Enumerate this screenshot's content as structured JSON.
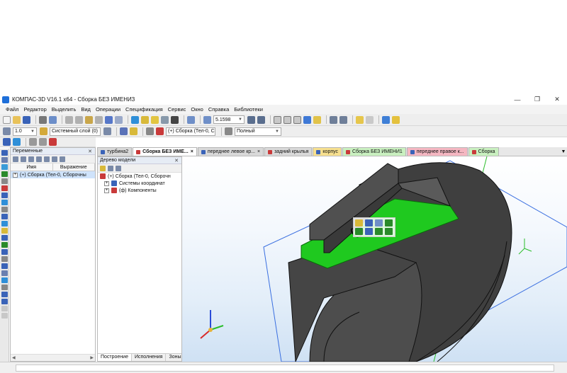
{
  "window": {
    "title": "КОМПАС-3D V16.1 x64 - Сборка БЕЗ ИМЕНИ3",
    "minimize": "—",
    "restore": "❐",
    "close": "✕"
  },
  "menu": [
    "Файл",
    "Редактор",
    "Выделить",
    "Вид",
    "Операции",
    "Спецификация",
    "Сервис",
    "Окно",
    "Справка",
    "Библиотеки"
  ],
  "toolbar1": {
    "zoom_value": "5.1598"
  },
  "toolbar2": {
    "line_scale": "1.0",
    "layer": "Системный слой (0)",
    "context": "(+) Сборка (Тел-0, С",
    "display_mode": "Полный"
  },
  "variables_panel": {
    "title": "Переменные",
    "pin": "✕",
    "col_name": "Имя",
    "col_expression": "Выражение",
    "rows": [
      {
        "expander": "+",
        "label": "(+) Сборка (Тел-0, Сборочны"
      }
    ]
  },
  "model_tree": {
    "title": "Дерево модели",
    "pin": "✕",
    "items": [
      {
        "level": 0,
        "expander": "",
        "label": "(+) Сборка (Тел-0, Сборочн"
      },
      {
        "level": 1,
        "expander": "+",
        "label": "Системы координат"
      },
      {
        "level": 1,
        "expander": "+",
        "label": "(ф) Компоненты"
      }
    ],
    "bottom_tabs": [
      "Построение",
      "Исполнения",
      "Зоны"
    ]
  },
  "doc_tabs": [
    {
      "label": "турбина2",
      "color": "#d9d9d9",
      "closable": false,
      "active": false
    },
    {
      "label": "Сборка БЕЗ ИМЕ...",
      "color": "#ffffff",
      "closable": true,
      "active": true
    },
    {
      "label": "переднее левое кр...",
      "color": "#d9d9d9",
      "closable": true,
      "active": false
    },
    {
      "label": "задний крылья",
      "color": "#d9d9d9",
      "closable": false,
      "active": false
    },
    {
      "label": "корпус",
      "color": "#f7e08f",
      "closable": false,
      "active": false
    },
    {
      "label": "Сборка БЕЗ ИМЕНИ1",
      "color": "#c9f0c0",
      "closable": false,
      "active": false
    },
    {
      "label": "переднее правое к...",
      "color": "#f5b7c2",
      "closable": false,
      "active": false
    },
    {
      "label": "Сборка",
      "color": "#c9f0c0",
      "closable": false,
      "active": false
    }
  ],
  "colors": {
    "selection_green": "#1fc91f",
    "model_gray": "#4a4a4a",
    "plane_blue": "#3a6fe0",
    "axis_green": "#2bbd2b"
  },
  "icons": {
    "tabs_scroll": "▼",
    "scroll_left": "◀",
    "scroll_right": "▶"
  }
}
